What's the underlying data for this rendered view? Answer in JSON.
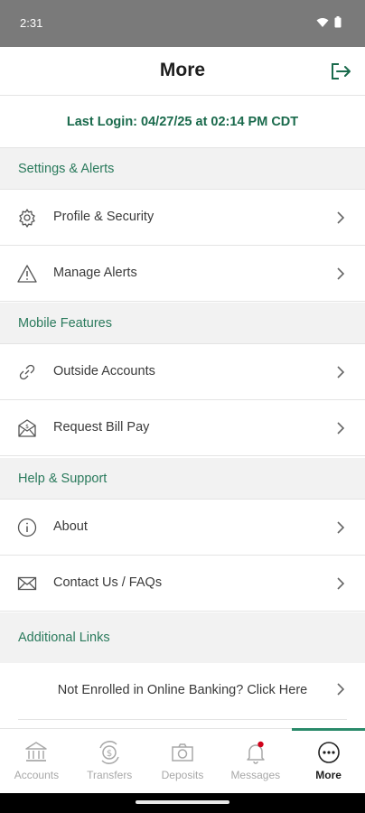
{
  "status_bar": {
    "time": "2:31"
  },
  "header": {
    "title": "More"
  },
  "last_login": "Last Login: 04/27/25 at 02:14 PM CDT",
  "sections": [
    {
      "title": "Settings & Alerts",
      "items": [
        {
          "label": "Profile & Security",
          "icon": "gear-icon"
        },
        {
          "label": "Manage Alerts",
          "icon": "warning-icon"
        }
      ]
    },
    {
      "title": "Mobile Features",
      "items": [
        {
          "label": "Outside Accounts",
          "icon": "link-icon"
        },
        {
          "label": "Request Bill Pay",
          "icon": "bill-pay-icon"
        }
      ]
    },
    {
      "title": "Help & Support",
      "items": [
        {
          "label": "About",
          "icon": "info-icon"
        },
        {
          "label": "Contact Us / FAQs",
          "icon": "envelope-icon"
        }
      ]
    },
    {
      "title": "Additional Links",
      "items": [
        {
          "label": "Not Enrolled in Online Banking? Click Here"
        }
      ]
    }
  ],
  "bottom_nav": {
    "items": [
      {
        "label": "Accounts",
        "icon": "bank-icon"
      },
      {
        "label": "Transfers",
        "icon": "transfer-icon"
      },
      {
        "label": "Deposits",
        "icon": "camera-icon"
      },
      {
        "label": "Messages",
        "icon": "bell-icon"
      },
      {
        "label": "More",
        "icon": "more-icon",
        "active": true
      }
    ]
  },
  "colors": {
    "accent": "#1a6a4c",
    "section_text": "#2a7a5c",
    "section_bg": "#f2f2f2",
    "notification_dot": "#d0021b"
  }
}
